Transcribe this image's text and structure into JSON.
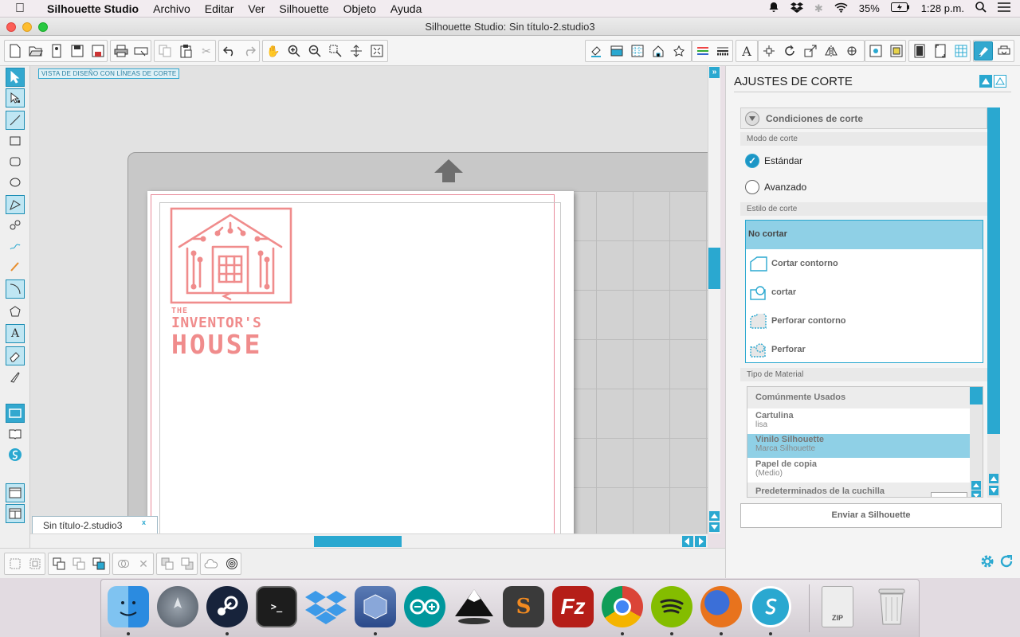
{
  "menubar": {
    "app": "Silhouette Studio",
    "items": [
      "Archivo",
      "Editar",
      "Ver",
      "Silhouette",
      "Objeto",
      "Ayuda"
    ],
    "battery": "35%",
    "clock": "1:28 p.m."
  },
  "window": {
    "title": "Silhouette Studio: Sin título-2.studio3"
  },
  "canvas": {
    "view_label": "VISTA DE DISEÑO CON LÍNEAS DE CORTE",
    "logo_line1": "THE",
    "logo_line2": "INVENTOR'S",
    "logo_line3": "HOUSE",
    "logo_color": "#f08c8c"
  },
  "document_tab": {
    "label": "Sin título-2.studio3",
    "close": "x"
  },
  "panel": {
    "title": "AJUSTES DE CORTE",
    "section_header": "Condiciones de corte",
    "cut_mode": {
      "label": "Modo de corte",
      "options": [
        {
          "label": "Estándar",
          "selected": true
        },
        {
          "label": "Avanzado",
          "selected": false
        }
      ]
    },
    "cut_style": {
      "label": "Estilo de corte",
      "options": [
        {
          "label": "No cortar",
          "selected": true
        },
        {
          "label": "Cortar contorno",
          "selected": false
        },
        {
          "label": "cortar",
          "selected": false
        },
        {
          "label": "Perforar contorno",
          "selected": false
        },
        {
          "label": "Perforar",
          "selected": false
        }
      ]
    },
    "material": {
      "label": "Tipo de Material",
      "list_header": "Comúnmente Usados",
      "items": [
        {
          "name": "Cartulina",
          "sub": "lisa",
          "selected": false
        },
        {
          "name": "Vinilo Silhouette",
          "sub": "Marca Silhouette",
          "selected": true
        },
        {
          "name": "Papel de copia",
          "sub": "(Medio)",
          "selected": false
        },
        {
          "name": "Predeterminados de la cuchilla",
          "sub": "",
          "selected": false
        }
      ]
    },
    "send_button": "Enviar a Silhouette"
  },
  "colors": {
    "accent": "#33a8cf",
    "selection": "#8fd0e6"
  }
}
